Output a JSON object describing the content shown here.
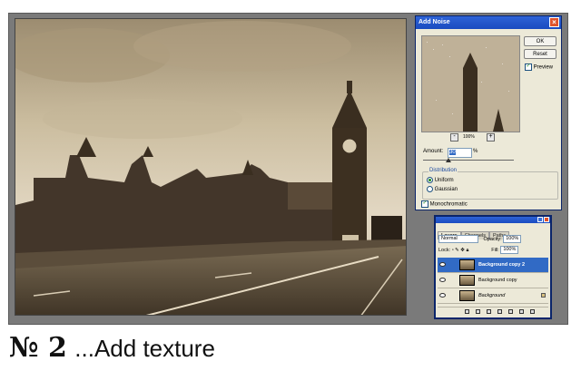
{
  "dialog": {
    "title": "Add Noise",
    "ok_label": "OK",
    "reset_label": "Reset",
    "preview_label": "Preview",
    "preview_checked": true,
    "zoom_level": "100%",
    "amount_label": "Amount:",
    "amount_value": "30",
    "amount_unit": "%",
    "distribution_label": "Distribution",
    "uniform_label": "Uniform",
    "gaussian_label": "Gaussian",
    "selected_distribution": "Uniform",
    "monochromatic_label": "Monochromatic",
    "monochromatic_checked": true
  },
  "layers_panel": {
    "tabs": [
      "Layers",
      "Channels",
      "Paths"
    ],
    "active_tab": "Layers",
    "blend_mode": "Normal",
    "opacity_label": "Opacity:",
    "opacity_value": "100%",
    "lock_label": "Lock:",
    "fill_label": "Fill:",
    "fill_value": "100%",
    "layers": [
      {
        "name": "Background copy 2",
        "selected": true
      },
      {
        "name": "Background copy",
        "selected": false
      },
      {
        "name": "Background",
        "selected": false,
        "locked": true
      }
    ]
  },
  "caption": {
    "number": "№ 2",
    "text": "...Add texture"
  },
  "colors": {
    "canvas_bg": "#7a7a7a",
    "sepia_light": "#d8cbb3",
    "sepia_dark": "#2e2418",
    "title_blue": "#1a4bc0",
    "selection_blue": "#316ac5"
  }
}
